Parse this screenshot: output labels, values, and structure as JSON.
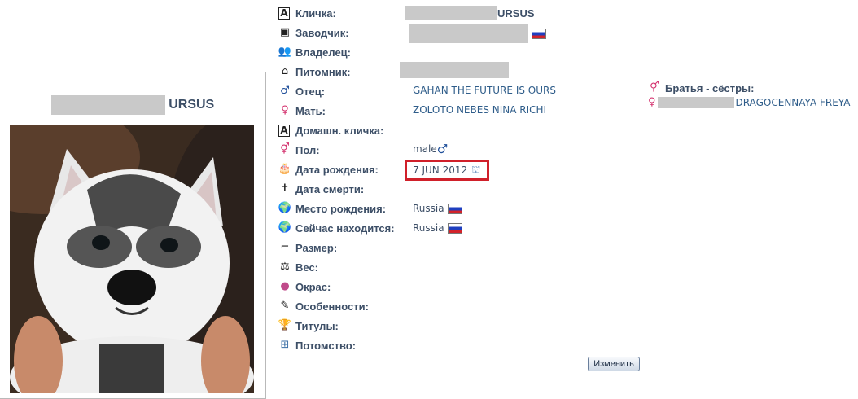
{
  "dog": {
    "name_suffix": "URSUS",
    "name_suffix_top": "URSUS"
  },
  "fields": [
    {
      "label": "Кличка:",
      "icon": "letter-a-icon",
      "glyph": "A"
    },
    {
      "label": "Заводчик:",
      "icon": "breeder-card-icon",
      "glyph": "▣"
    },
    {
      "label": "Владелец:",
      "icon": "owner-people-icon",
      "glyph": "👥"
    },
    {
      "label": "Питомник:",
      "icon": "kennel-house-icon",
      "glyph": "⌂"
    },
    {
      "label": "Отец:",
      "icon": "male-sign-icon",
      "glyph": "♂"
    },
    {
      "label": "Мать:",
      "icon": "female-sign-icon",
      "glyph": "♀"
    },
    {
      "label": "Домашн. кличка:",
      "icon": "letter-a-icon",
      "glyph": "A"
    },
    {
      "label": "Пол:",
      "icon": "gender-sign-icon",
      "glyph": "⚥"
    },
    {
      "label": "Дата рождения:",
      "icon": "birthday-cake-icon",
      "glyph": "🎂"
    },
    {
      "label": "Дата смерти:",
      "icon": "cross-icon",
      "glyph": "✝"
    },
    {
      "label": "Место рождения:",
      "icon": "globe-icon",
      "glyph": "🌍"
    },
    {
      "label": "Сейчас находится:",
      "icon": "globe-icon",
      "glyph": "🌍"
    },
    {
      "label": "Размер:",
      "icon": "ruler-icon",
      "glyph": "⌐"
    },
    {
      "label": "Вес:",
      "icon": "scale-icon",
      "glyph": "⚖"
    },
    {
      "label": "Окрас:",
      "icon": "color-palette-icon",
      "glyph": "●"
    },
    {
      "label": "Особенности:",
      "icon": "notes-icon",
      "glyph": "✎"
    },
    {
      "label": "Титулы:",
      "icon": "trophy-icon",
      "glyph": "🏆"
    },
    {
      "label": "Потомство:",
      "icon": "pedigree-tree-icon",
      "glyph": "⊞"
    }
  ],
  "values": {
    "father": "GAHAN THE FUTURE IS OURS",
    "mother": "ZOLOTO NEBES NINA RICHI",
    "sex": "male",
    "birth_date": "7 JUN 2012",
    "birth_place": "Russia",
    "current_location": "Russia"
  },
  "siblings": {
    "label": "Братья - сёстры:",
    "item": "DRAGOCENNAYA FREYA"
  },
  "actions": {
    "edit": "Изменить"
  },
  "colors": {
    "label": "#3d4f67",
    "link": "#2f5d8a",
    "highlight": "#d0202a",
    "male": "#1f4f9a",
    "female": "#d4336f"
  }
}
